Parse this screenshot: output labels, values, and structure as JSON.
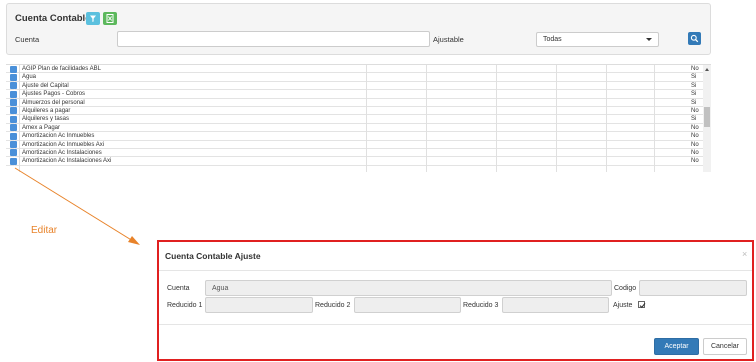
{
  "filter": {
    "title": "Cuenta Contable",
    "cuenta_label": "Cuenta",
    "cuenta_value": "",
    "ajustable_label": "Ajustable",
    "ajustable_selected": "Todas"
  },
  "icons": {
    "filter": "filter-icon",
    "excel": "excel-export-icon",
    "search": "search-icon",
    "edit": "pencil-icon",
    "close": "close-icon",
    "check": "checkmark-icon"
  },
  "grid": {
    "rows": [
      {
        "name": "AGIP Plan de facilidades ABL",
        "value": "No"
      },
      {
        "name": "Agua",
        "value": "Si"
      },
      {
        "name": "Ajuste del Capital",
        "value": "Si"
      },
      {
        "name": "Ajustes Pagos - Cobros",
        "value": "Si"
      },
      {
        "name": "Almuerzos del personal",
        "value": "Si"
      },
      {
        "name": "Alquileres a pagar",
        "value": "No"
      },
      {
        "name": "Alquileres y tasas",
        "value": "Si"
      },
      {
        "name": "Amex a Pagar",
        "value": "No"
      },
      {
        "name": "Amortizacion Ac Inmuebles",
        "value": "No"
      },
      {
        "name": "Amortizacion Ac Inmuebles Axi",
        "value": "No"
      },
      {
        "name": "Amortizacion Ac Instalaciones",
        "value": "No"
      },
      {
        "name": "Amortizacion Ac Instalaciones Axi",
        "value": "No"
      }
    ]
  },
  "annotation": {
    "label": "Editar"
  },
  "modal": {
    "title": "Cuenta Contable Ajuste",
    "close": "×",
    "cuenta_label": "Cuenta",
    "cuenta_value": "Agua",
    "codigo_label": "Codigo",
    "codigo_value": "",
    "reducido1_label": "Reducido 1",
    "reducido1_value": "",
    "reducido2_label": "Reducido 2",
    "reducido2_value": "",
    "reducido3_label": "Reducido 3",
    "reducido3_value": "",
    "ajuste_label": "Ajuste",
    "ajuste_checked": true,
    "aceptar_label": "Aceptar",
    "cancelar_label": "Cancelar"
  },
  "colors": {
    "primary": "#337ab7",
    "info": "#5bc0de",
    "success": "#5cb85c",
    "highlight_border": "#e02020",
    "annotation": "#e8832a"
  }
}
